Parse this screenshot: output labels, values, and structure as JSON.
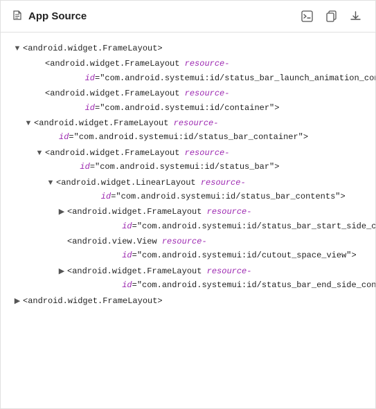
{
  "header": {
    "title": "App Source",
    "icon": "file-icon",
    "actions": [
      {
        "name": "terminal-button",
        "label": ">_"
      },
      {
        "name": "copy-button",
        "label": "⧉"
      },
      {
        "name": "download-button",
        "label": "⬇"
      }
    ]
  },
  "tree": [
    {
      "id": "node1",
      "indent": 0,
      "toggle": "down",
      "tag": "<android.widget.FrameLayout>",
      "attr_name": "",
      "attr_value": ""
    },
    {
      "id": "node2",
      "indent": 2,
      "toggle": "none",
      "tag": "<android.widget.FrameLayout ",
      "attr_name": "resource-id",
      "attr_value": "=\"com.android.systemui:id/status_bar_launch_animation_container\">"
    },
    {
      "id": "node3",
      "indent": 2,
      "toggle": "none",
      "tag": "<android.widget.FrameLayout ",
      "attr_name": "resource-id",
      "attr_value": "=\"com.android.systemui:id/container\">"
    },
    {
      "id": "node4",
      "indent": 2,
      "toggle": "down",
      "tag": "<android.widget.FrameLayout ",
      "attr_name": "resource-id",
      "attr_value": "=\"com.android.systemui:id/status_bar_container\">"
    },
    {
      "id": "node5",
      "indent": 4,
      "toggle": "down",
      "tag": "<android.widget.FrameLayout ",
      "attr_name": "resource-id",
      "attr_value": "=\"com.android.systemui:id/status_bar\">"
    },
    {
      "id": "node6",
      "indent": 6,
      "toggle": "down",
      "tag": "<android.widget.LinearLayout ",
      "attr_name": "resource-id",
      "attr_value": "=\"com.android.systemui:id/status_bar_contents\">"
    },
    {
      "id": "node7",
      "indent": 8,
      "toggle": "right",
      "tag": "<android.widget.FrameLayout ",
      "attr_name": "resource-id",
      "attr_value": "=\"com.android.systemui:id/status_bar_start_side_container\">"
    },
    {
      "id": "node8",
      "indent": 8,
      "toggle": "none",
      "tag": "<android.view.View ",
      "attr_name": "resource-id",
      "attr_value": "=\"com.android.systemui:id/cutout_space_view\">"
    },
    {
      "id": "node9",
      "indent": 8,
      "toggle": "right",
      "tag": "<android.widget.FrameLayout ",
      "attr_name": "resource-id",
      "attr_value": "=\"com.android.systemui:id/status_bar_end_side_container\">"
    },
    {
      "id": "node10",
      "indent": 0,
      "toggle": "right",
      "tag": "<android.widget.FrameLayout>",
      "attr_name": "",
      "attr_value": ""
    }
  ]
}
